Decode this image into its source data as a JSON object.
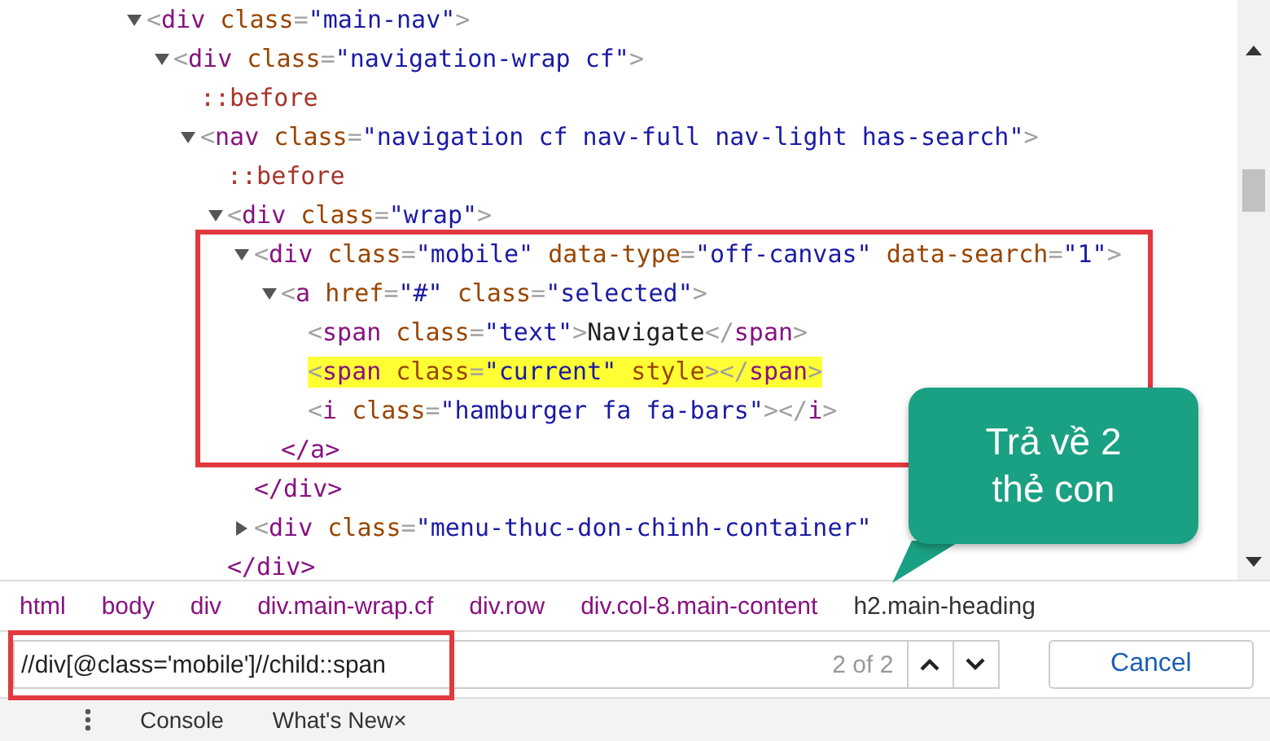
{
  "dom_tree": [
    {
      "expanded": true,
      "selected": false,
      "segments": [
        {
          "kind": "punct",
          "text": "<"
        },
        {
          "kind": "tag",
          "text": "div"
        },
        {
          "kind": "attr",
          "text": " class"
        },
        {
          "kind": "punct",
          "text": "="
        },
        {
          "kind": "value",
          "text": "\"main-nav\""
        },
        {
          "kind": "punct",
          "text": ">"
        }
      ],
      "children": [
        {
          "expanded": true,
          "selected": false,
          "segments": [
            {
              "kind": "punct",
              "text": "<"
            },
            {
              "kind": "tag",
              "text": "div"
            },
            {
              "kind": "attr",
              "text": " class"
            },
            {
              "kind": "punct",
              "text": "="
            },
            {
              "kind": "value",
              "text": "\"navigation-wrap cf\""
            },
            {
              "kind": "punct",
              "text": ">"
            }
          ],
          "children": [
            {
              "selected": false,
              "segments": [
                {
                  "kind": "pseudo",
                  "text": "::before"
                }
              ]
            },
            {
              "expanded": true,
              "selected": false,
              "segments": [
                {
                  "kind": "punct",
                  "text": "<"
                },
                {
                  "kind": "tag",
                  "text": "nav"
                },
                {
                  "kind": "attr",
                  "text": " class"
                },
                {
                  "kind": "punct",
                  "text": "="
                },
                {
                  "kind": "value",
                  "text": "\"navigation cf nav-full nav-light has-search\""
                },
                {
                  "kind": "punct",
                  "text": ">"
                }
              ],
              "children": [
                {
                  "selected": false,
                  "segments": [
                    {
                      "kind": "pseudo",
                      "text": "::before"
                    }
                  ]
                },
                {
                  "expanded": true,
                  "selected": false,
                  "segments": [
                    {
                      "kind": "punct",
                      "text": "<"
                    },
                    {
                      "kind": "tag",
                      "text": "div"
                    },
                    {
                      "kind": "attr",
                      "text": " class"
                    },
                    {
                      "kind": "punct",
                      "text": "="
                    },
                    {
                      "kind": "value",
                      "text": "\"wrap\""
                    },
                    {
                      "kind": "punct",
                      "text": ">"
                    }
                  ],
                  "closing": "</div>",
                  "children": [
                    {
                      "expanded": true,
                      "selected": false,
                      "segments": [
                        {
                          "kind": "punct",
                          "text": "<"
                        },
                        {
                          "kind": "tag",
                          "text": "div"
                        },
                        {
                          "kind": "attr",
                          "text": " class"
                        },
                        {
                          "kind": "punct",
                          "text": "="
                        },
                        {
                          "kind": "value",
                          "text": "\"mobile\""
                        },
                        {
                          "kind": "attr",
                          "text": " data-type"
                        },
                        {
                          "kind": "punct",
                          "text": "="
                        },
                        {
                          "kind": "value",
                          "text": "\"off-canvas\""
                        },
                        {
                          "kind": "attr",
                          "text": " data-search"
                        },
                        {
                          "kind": "punct",
                          "text": "="
                        },
                        {
                          "kind": "value",
                          "text": "\"1\""
                        },
                        {
                          "kind": "punct",
                          "text": ">"
                        }
                      ],
                      "closing": "</div>",
                      "children": [
                        {
                          "expanded": true,
                          "selected": false,
                          "segments": [
                            {
                              "kind": "punct",
                              "text": "<"
                            },
                            {
                              "kind": "tag",
                              "text": "a"
                            },
                            {
                              "kind": "attr",
                              "text": " href"
                            },
                            {
                              "kind": "punct",
                              "text": "="
                            },
                            {
                              "kind": "value",
                              "text": "\"#\""
                            },
                            {
                              "kind": "attr",
                              "text": " class"
                            },
                            {
                              "kind": "punct",
                              "text": "="
                            },
                            {
                              "kind": "value",
                              "text": "\"selected\""
                            },
                            {
                              "kind": "punct",
                              "text": ">"
                            }
                          ],
                          "closing": "</a>",
                          "children": [
                            {
                              "selected": false,
                              "segments": [
                                {
                                  "kind": "punct",
                                  "text": "<"
                                },
                                {
                                  "kind": "tag",
                                  "text": "span"
                                },
                                {
                                  "kind": "attr",
                                  "text": " class"
                                },
                                {
                                  "kind": "punct",
                                  "text": "="
                                },
                                {
                                  "kind": "value",
                                  "text": "\"text\""
                                },
                                {
                                  "kind": "punct",
                                  "text": ">"
                                },
                                {
                                  "kind": "text",
                                  "text": "Navigate"
                                },
                                {
                                  "kind": "punct",
                                  "text": "</"
                                },
                                {
                                  "kind": "tag",
                                  "text": "span"
                                },
                                {
                                  "kind": "punct",
                                  "text": ">"
                                }
                              ]
                            },
                            {
                              "selected": true,
                              "segments": [
                                {
                                  "kind": "punct",
                                  "text": "<"
                                },
                                {
                                  "kind": "tag",
                                  "text": "span"
                                },
                                {
                                  "kind": "attr",
                                  "text": " class"
                                },
                                {
                                  "kind": "punct",
                                  "text": "="
                                },
                                {
                                  "kind": "value",
                                  "text": "\"current\""
                                },
                                {
                                  "kind": "attr",
                                  "text": " style"
                                },
                                {
                                  "kind": "punct",
                                  "text": "></"
                                },
                                {
                                  "kind": "tag",
                                  "text": "span"
                                },
                                {
                                  "kind": "punct",
                                  "text": ">"
                                }
                              ]
                            },
                            {
                              "selected": false,
                              "segments": [
                                {
                                  "kind": "punct",
                                  "text": "<"
                                },
                                {
                                  "kind": "tag",
                                  "text": "i"
                                },
                                {
                                  "kind": "attr",
                                  "text": " class"
                                },
                                {
                                  "kind": "punct",
                                  "text": "="
                                },
                                {
                                  "kind": "value",
                                  "text": "\"hamburger fa fa-bars\""
                                },
                                {
                                  "kind": "punct",
                                  "text": "></"
                                },
                                {
                                  "kind": "tag",
                                  "text": "i"
                                },
                                {
                                  "kind": "punct",
                                  "text": ">"
                                }
                              ]
                            }
                          ]
                        }
                      ]
                    },
                    {
                      "expanded": false,
                      "selected": false,
                      "segments": [
                        {
                          "kind": "punct",
                          "text": "<"
                        },
                        {
                          "kind": "tag",
                          "text": "div"
                        },
                        {
                          "kind": "attr",
                          "text": " class"
                        },
                        {
                          "kind": "punct",
                          "text": "="
                        },
                        {
                          "kind": "value",
                          "text": "\"menu-thuc-don-chinh-container\""
                        }
                      ]
                    }
                  ]
                }
              ]
            }
          ]
        }
      ]
    }
  ],
  "breadcrumbs": [
    {
      "text": "html",
      "kind": "tag"
    },
    {
      "text": "body",
      "kind": "tag"
    },
    {
      "text": "div",
      "kind": "tag"
    },
    {
      "text": "div.main-wrap.cf",
      "kind": "tag"
    },
    {
      "text": "div.row",
      "kind": "tag"
    },
    {
      "text": "div.col-8.main-content",
      "kind": "tag"
    },
    {
      "text": "h2.main-heading",
      "kind": "heading"
    }
  ],
  "search": {
    "value": "//div[@class='mobile']//child::span",
    "match_count": "2 of 2",
    "cancel_label": "Cancel"
  },
  "drawer_tabs": [
    {
      "label": "Console"
    },
    {
      "label": "What's New",
      "close_glyph": "×"
    }
  ],
  "callout": {
    "text": "Trả về 2 thẻ con"
  }
}
